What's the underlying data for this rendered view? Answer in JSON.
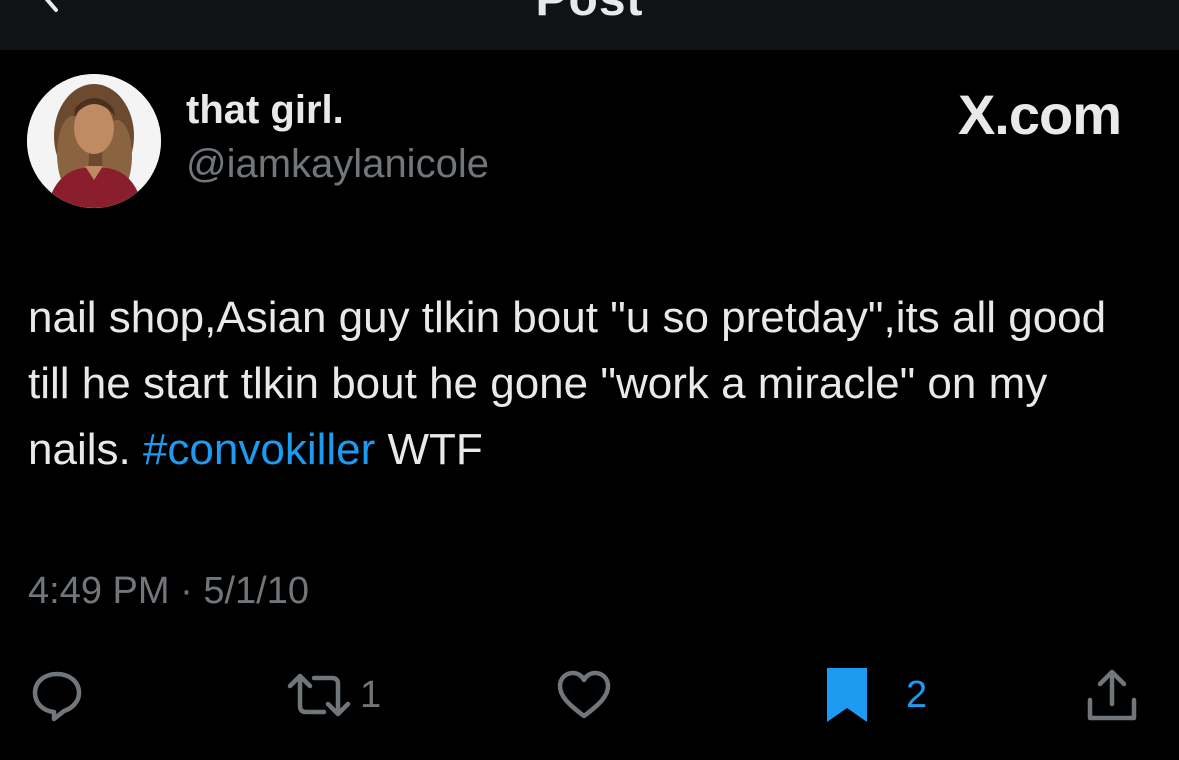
{
  "header": {
    "title": "Post"
  },
  "author": {
    "display_name": "that girl.",
    "handle": "@iamkaylanicole"
  },
  "brand": "X.com",
  "tweet": {
    "text_before": "nail shop,Asian guy tlkin bout \"u so pretday\",its all good till he start tlkin bout he gone \"work a miracle\" on my nails. ",
    "hashtag": "#convokiller",
    "text_after": " WTF"
  },
  "meta": {
    "time": "4:49 PM",
    "separator": "·",
    "date": "5/1/10"
  },
  "actions": {
    "retweet_count": "1",
    "bookmark_count": "2"
  },
  "colors": {
    "background": "#000000",
    "primary_text": "#e7e9ea",
    "secondary_text": "#71767b",
    "accent": "#1d9bf0"
  },
  "icons": [
    "back-arrow-icon",
    "reply-icon",
    "retweet-icon",
    "like-icon",
    "bookmark-icon",
    "share-icon"
  ]
}
